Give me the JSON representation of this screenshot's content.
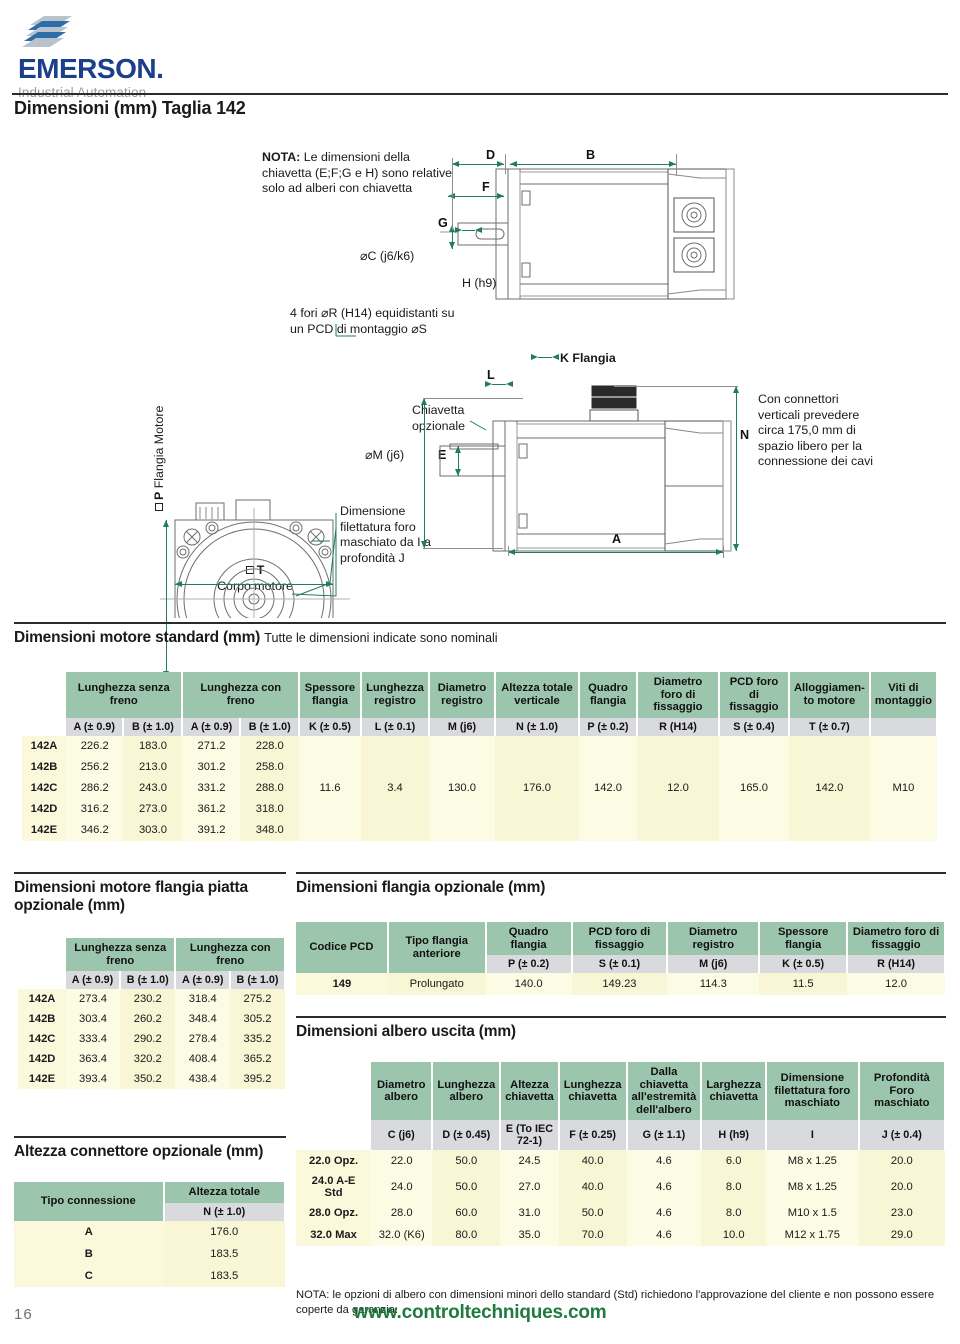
{
  "brand": {
    "name": "EMERSON",
    "name_suffix": ".",
    "tagline": "Industrial Automation",
    "logo_icon": "emerson-chevron-logo",
    "color": "#1b3f8b"
  },
  "page_title": "Dimensioni (mm) Taglia 142",
  "diagram": {
    "note": {
      "bold_prefix": "NOTA:",
      "text": " Le dimensioni della chiavetta (E;F;G e H) sono relative solo ad alberi con chiavetta"
    },
    "callouts": {
      "shaft_dia": "⌀C (j6/k6)",
      "key_h": "H (h9)",
      "holes": "4 fori ⌀R (H14) equidistanti su un PCD di montaggio ⌀S",
      "flange_k": "K Flangia",
      "key_optional": "Chiavetta opzionale",
      "register_m": "⌀M (j6)",
      "thread": "Dimensione filettatura foro maschiato da I a profondità J",
      "motor_body": "Corpo motore",
      "motor_body_sym": "T",
      "motor_flange": "Flangia Motore",
      "motor_flange_sym": "P",
      "connector_note": "Con connettori verticali prevedere circa 175,0 mm di spazio libero per la connessione dei cavi"
    },
    "dims": [
      "D",
      "B",
      "F",
      "G",
      "E",
      "L",
      "A",
      "N"
    ]
  },
  "standard_table": {
    "heading": "Dimensioni motore standard (mm)",
    "subheading": "Tutte le dimensioni indicate sono nominali",
    "groups": [
      {
        "label": "Lunghezza senza freno",
        "span": 2
      },
      {
        "label": "Lunghezza con freno",
        "span": 2
      },
      {
        "label": "Spessore flangia",
        "span": 1
      },
      {
        "label": "Lunghezza registro",
        "span": 1
      },
      {
        "label": "Diametro registro",
        "span": 1
      },
      {
        "label": "Altezza totale verticale",
        "span": 1
      },
      {
        "label": "Quadro flangia",
        "span": 1
      },
      {
        "label": "Diametro foro di fissaggio",
        "span": 1
      },
      {
        "label": "PCD foro di fissaggio",
        "span": 1
      },
      {
        "label": "Alloggiamen- to motore",
        "span": 1
      },
      {
        "label": "Viti di montaggio",
        "span": 1
      }
    ],
    "symbols": [
      "A (± 0.9)",
      "B (± 1.0)",
      "A (± 0.9)",
      "B (± 1.0)",
      "K (± 0.5)",
      "L (± 0.1)",
      "M (j6)",
      "N (± 1.0)",
      "P (± 0.2)",
      "R (H14)",
      "S (± 0.4)",
      "T (± 0.7)",
      ""
    ],
    "rows": [
      {
        "label": "142A",
        "values": [
          "226.2",
          "183.0",
          "271.2",
          "228.0"
        ]
      },
      {
        "label": "142B",
        "values": [
          "256.2",
          "213.0",
          "301.2",
          "258.0"
        ]
      },
      {
        "label": "142C",
        "values": [
          "286.2",
          "243.0",
          "331.2",
          "288.0"
        ]
      },
      {
        "label": "142D",
        "values": [
          "316.2",
          "273.0",
          "361.2",
          "318.0"
        ]
      },
      {
        "label": "142E",
        "values": [
          "346.2",
          "303.0",
          "391.2",
          "348.0"
        ]
      }
    ],
    "merged": [
      "11.6",
      "3.4",
      "130.0",
      "176.0",
      "142.0",
      "12.0",
      "165.0",
      "142.0",
      "M10"
    ]
  },
  "flat_flange_table": {
    "heading": "Dimensioni motore flangia piatta opzionale (mm)",
    "groups": [
      {
        "label": "Lunghezza senza freno"
      },
      {
        "label": "Lunghezza con freno"
      }
    ],
    "symbols": [
      "A (± 0.9)",
      "B (± 1.0)",
      "A (± 0.9)",
      "B (± 1.0)"
    ],
    "rows": [
      {
        "label": "142A",
        "values": [
          "273.4",
          "230.2",
          "318.4",
          "275.2"
        ]
      },
      {
        "label": "142B",
        "values": [
          "303.4",
          "260.2",
          "348.4",
          "305.2"
        ]
      },
      {
        "label": "142C",
        "values": [
          "333.4",
          "290.2",
          "278.4",
          "335.2"
        ]
      },
      {
        "label": "142D",
        "values": [
          "363.4",
          "320.2",
          "408.4",
          "365.2"
        ]
      },
      {
        "label": "142E",
        "values": [
          "393.4",
          "350.2",
          "438.4",
          "395.2"
        ]
      }
    ]
  },
  "connector_height_table": {
    "heading": "Altezza connettore opzionale (mm)",
    "col1_header": "Tipo connessione",
    "col2_header": "Altezza totale",
    "col2_symbol": "N (± 1.0)",
    "rows": [
      {
        "label": "A",
        "value": "176.0"
      },
      {
        "label": "B",
        "value": "183.5"
      },
      {
        "label": "C",
        "value": "183.5"
      }
    ]
  },
  "optional_flange_table": {
    "heading": "Dimensioni flangia opzionale (mm)",
    "headers": [
      "Codice PCD",
      "Tipo flangia anteriore",
      "Quadro flangia",
      "PCD foro di fissaggio",
      "Diametro registro",
      "Spessore flangia",
      "Diametro foro di fissaggio"
    ],
    "symbols": [
      "",
      "",
      "P (± 0.2)",
      "S (± 0.1)",
      "M (j6)",
      "K (± 0.5)",
      "R (H14)"
    ],
    "rows": [
      {
        "values": [
          "149",
          "Prolungato",
          "140.0",
          "149.23",
          "114.3",
          "11.5",
          "12.0"
        ]
      }
    ]
  },
  "shaft_table": {
    "heading": "Dimensioni albero uscita (mm)",
    "headers": [
      "Diametro albero",
      "Lunghezza albero",
      "Altezza chiavetta",
      "Lunghezza chiavetta",
      "Dalla chiavetta all'estremità dell'albero",
      "Larghezza chiavetta",
      "Dimensione filettatura foro maschiato",
      "Profondità Foro maschiato"
    ],
    "symbols": [
      "C (j6)",
      "D (± 0.45)",
      "E (To IEC 72-1)",
      "F (± 0.25)",
      "G (± 1.1)",
      "H (h9)",
      "I",
      "J (± 0.4)"
    ],
    "rows": [
      {
        "label": "22.0 Opz.",
        "values": [
          "22.0",
          "50.0",
          "24.5",
          "40.0",
          "4.6",
          "6.0",
          "M8 x 1.25",
          "20.0"
        ]
      },
      {
        "label": "24.0 A-E Std",
        "values": [
          "24.0",
          "50.0",
          "27.0",
          "40.0",
          "4.6",
          "8.0",
          "M8 x 1.25",
          "20.0"
        ]
      },
      {
        "label": "28.0 Opz.",
        "values": [
          "28.0",
          "60.0",
          "31.0",
          "50.0",
          "4.6",
          "8.0",
          "M10 x 1.5",
          "23.0"
        ]
      },
      {
        "label": "32.0 Max",
        "values": [
          "32.0 (K6)",
          "80.0",
          "35.0",
          "70.0",
          "4.6",
          "10.0",
          "M12 x 1.75",
          "29.0"
        ]
      }
    ],
    "note": "NOTA: le opzioni di albero con dimensioni minori dello standard (Std) richiedono l'approvazione del cliente e non possono essere coperte da garanzia."
  },
  "footer": {
    "page_number": "16",
    "url": "www.controltechniques.com",
    "url_color": "#1f7a3f"
  }
}
